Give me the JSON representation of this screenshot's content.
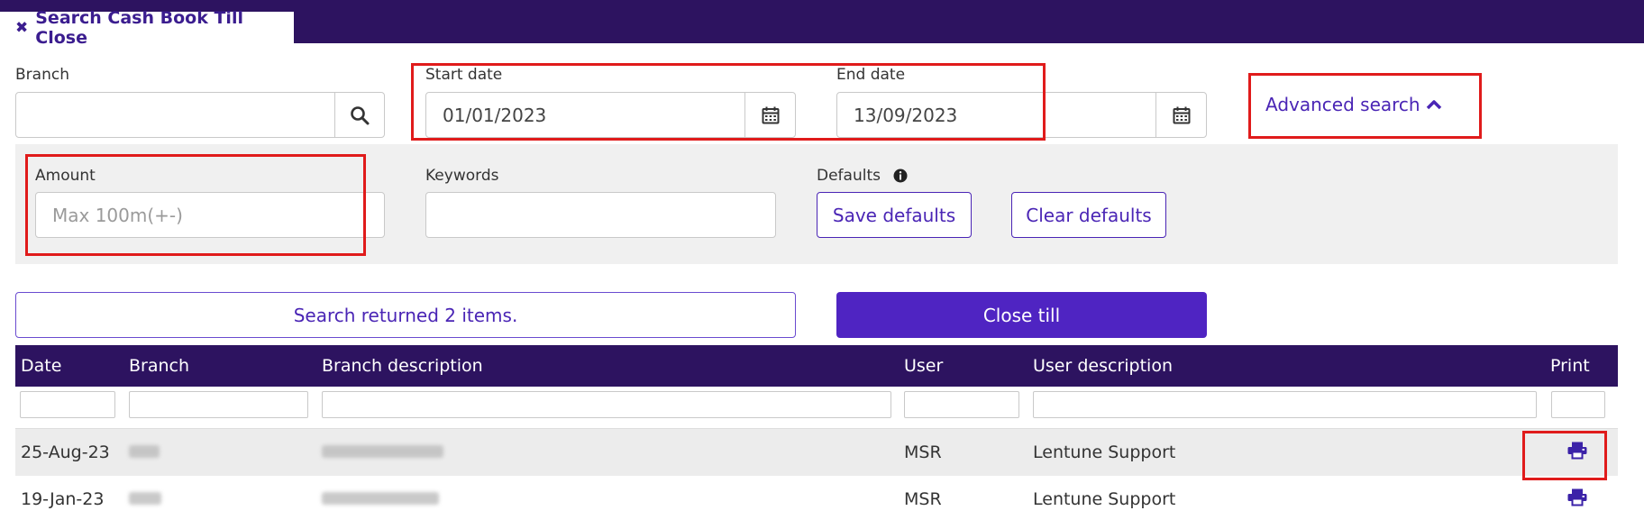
{
  "tab": {
    "title": "Search Cash Book Till Close",
    "close_glyph": "✖"
  },
  "filters": {
    "branch_label": "Branch",
    "branch_value": "",
    "start_date_label": "Start date",
    "start_date_value": "01/01/2023",
    "end_date_label": "End date",
    "end_date_value": "13/09/2023",
    "advanced_search_label": "Advanced search"
  },
  "advanced": {
    "amount_label": "Amount",
    "amount_placeholder": "Max 100m(+-)",
    "keywords_label": "Keywords",
    "keywords_value": "",
    "defaults_label": "Defaults",
    "save_defaults": "Save defaults",
    "clear_defaults": "Clear defaults"
  },
  "status": {
    "message": "Search returned 2 items."
  },
  "actions": {
    "close_till": "Close till"
  },
  "table": {
    "columns": [
      "Date",
      "Branch",
      "Branch description",
      "User",
      "User description",
      "Print"
    ],
    "rows": [
      {
        "date": "25-Aug-23",
        "branch": "",
        "branch_description": "",
        "user": "MSR",
        "user_description": "Lentune Support"
      },
      {
        "date": "19-Jan-23",
        "branch": "",
        "branch_description": "",
        "user": "MSR",
        "user_description": "Lentune Support"
      }
    ]
  },
  "colors": {
    "header": "#2d1360",
    "accent": "#4f24c2",
    "highlight": "#e01b1b",
    "panel": "#f0f0f0"
  },
  "icons": [
    "close-icon",
    "search-icon",
    "calendar-icon",
    "chevron-up-icon",
    "info-icon",
    "print-icon"
  ]
}
